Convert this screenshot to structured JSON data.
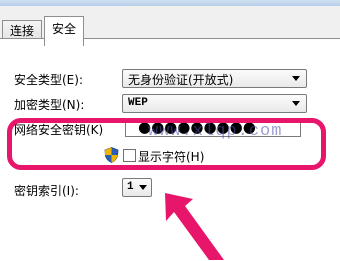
{
  "tabs": [
    {
      "label": "连接"
    },
    {
      "label": "安全"
    }
  ],
  "security_type": {
    "label": "安全类型(E):",
    "value": "无身份验证(开放式)"
  },
  "encryption_type": {
    "label": "加密类型(N):",
    "value": "WEP"
  },
  "network_key": {
    "label": "网络安全密钥(K)",
    "value": "●●●●●●●●●"
  },
  "show_chars": {
    "label": "显示字符(H)",
    "checked": false
  },
  "key_index": {
    "label": "密钥索引(I):",
    "value": "1"
  },
  "watermark": {
    "text": "www.xlqp.com"
  },
  "colors": {
    "highlight": "#e7166b",
    "arrow": "#e7166b"
  }
}
